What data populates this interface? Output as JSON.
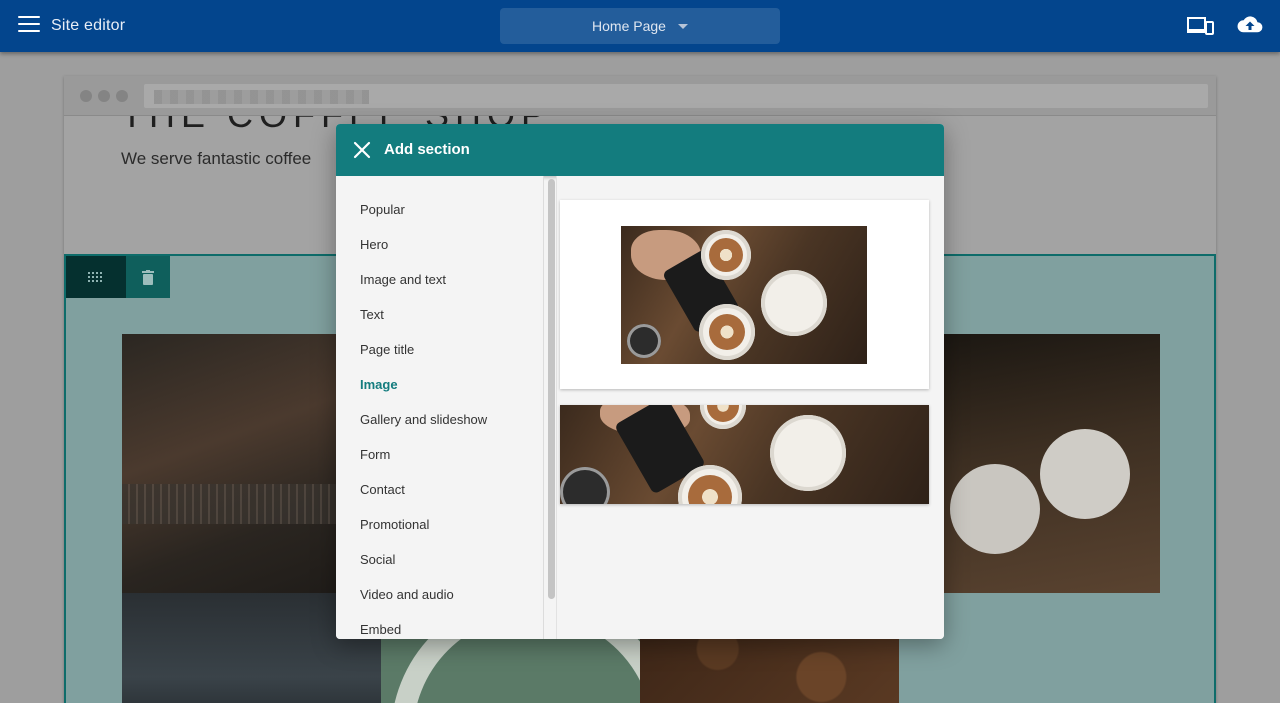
{
  "appbar": {
    "title": "Site editor",
    "page_selector": "Home Page",
    "icons": [
      "menu-icon",
      "devices-icon",
      "cloud-upload-icon"
    ]
  },
  "site": {
    "name": "THE COFFEE SHOP",
    "tagline": "We serve fantastic coffee"
  },
  "dialog": {
    "title": "Add section",
    "close_icon": "close-icon",
    "selected_category": "Image",
    "categories": [
      "Popular",
      "Hero",
      "Image and text",
      "Text",
      "Page title",
      "Image",
      "Gallery and slideshow",
      "Form",
      "Contact",
      "Promotional",
      "Social",
      "Video and audio",
      "Embed"
    ]
  },
  "colors": {
    "appbar": "#03458d",
    "dialog_header": "#137c7e",
    "accent": "#137c7e"
  }
}
